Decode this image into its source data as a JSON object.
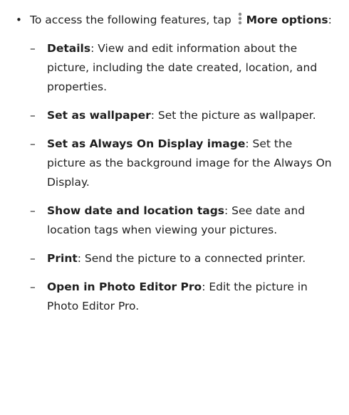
{
  "intro": {
    "bullet": "•",
    "text_before": "To access the following features, tap",
    "icon": "more-options-icon",
    "term": "More options",
    "text_after": ":"
  },
  "items": [
    {
      "dash": "–",
      "term": "Details",
      "description": ": View and edit information about the picture, including the date created, location, and properties."
    },
    {
      "dash": "–",
      "term": "Set as wallpaper",
      "description": ": Set the picture as wallpaper."
    },
    {
      "dash": "–",
      "term": "Set as Always On Display image",
      "description": ": Set the picture as the background image for the Always On Display."
    },
    {
      "dash": "–",
      "term": "Show date and location tags",
      "description": ": See date and location tags when viewing your pictures."
    },
    {
      "dash": "–",
      "term": "Print",
      "description": ": Send the picture to a connected printer."
    },
    {
      "dash": "–",
      "term": "Open in Photo Editor Pro",
      "description": ": Edit the picture in Photo Editor Pro."
    }
  ]
}
